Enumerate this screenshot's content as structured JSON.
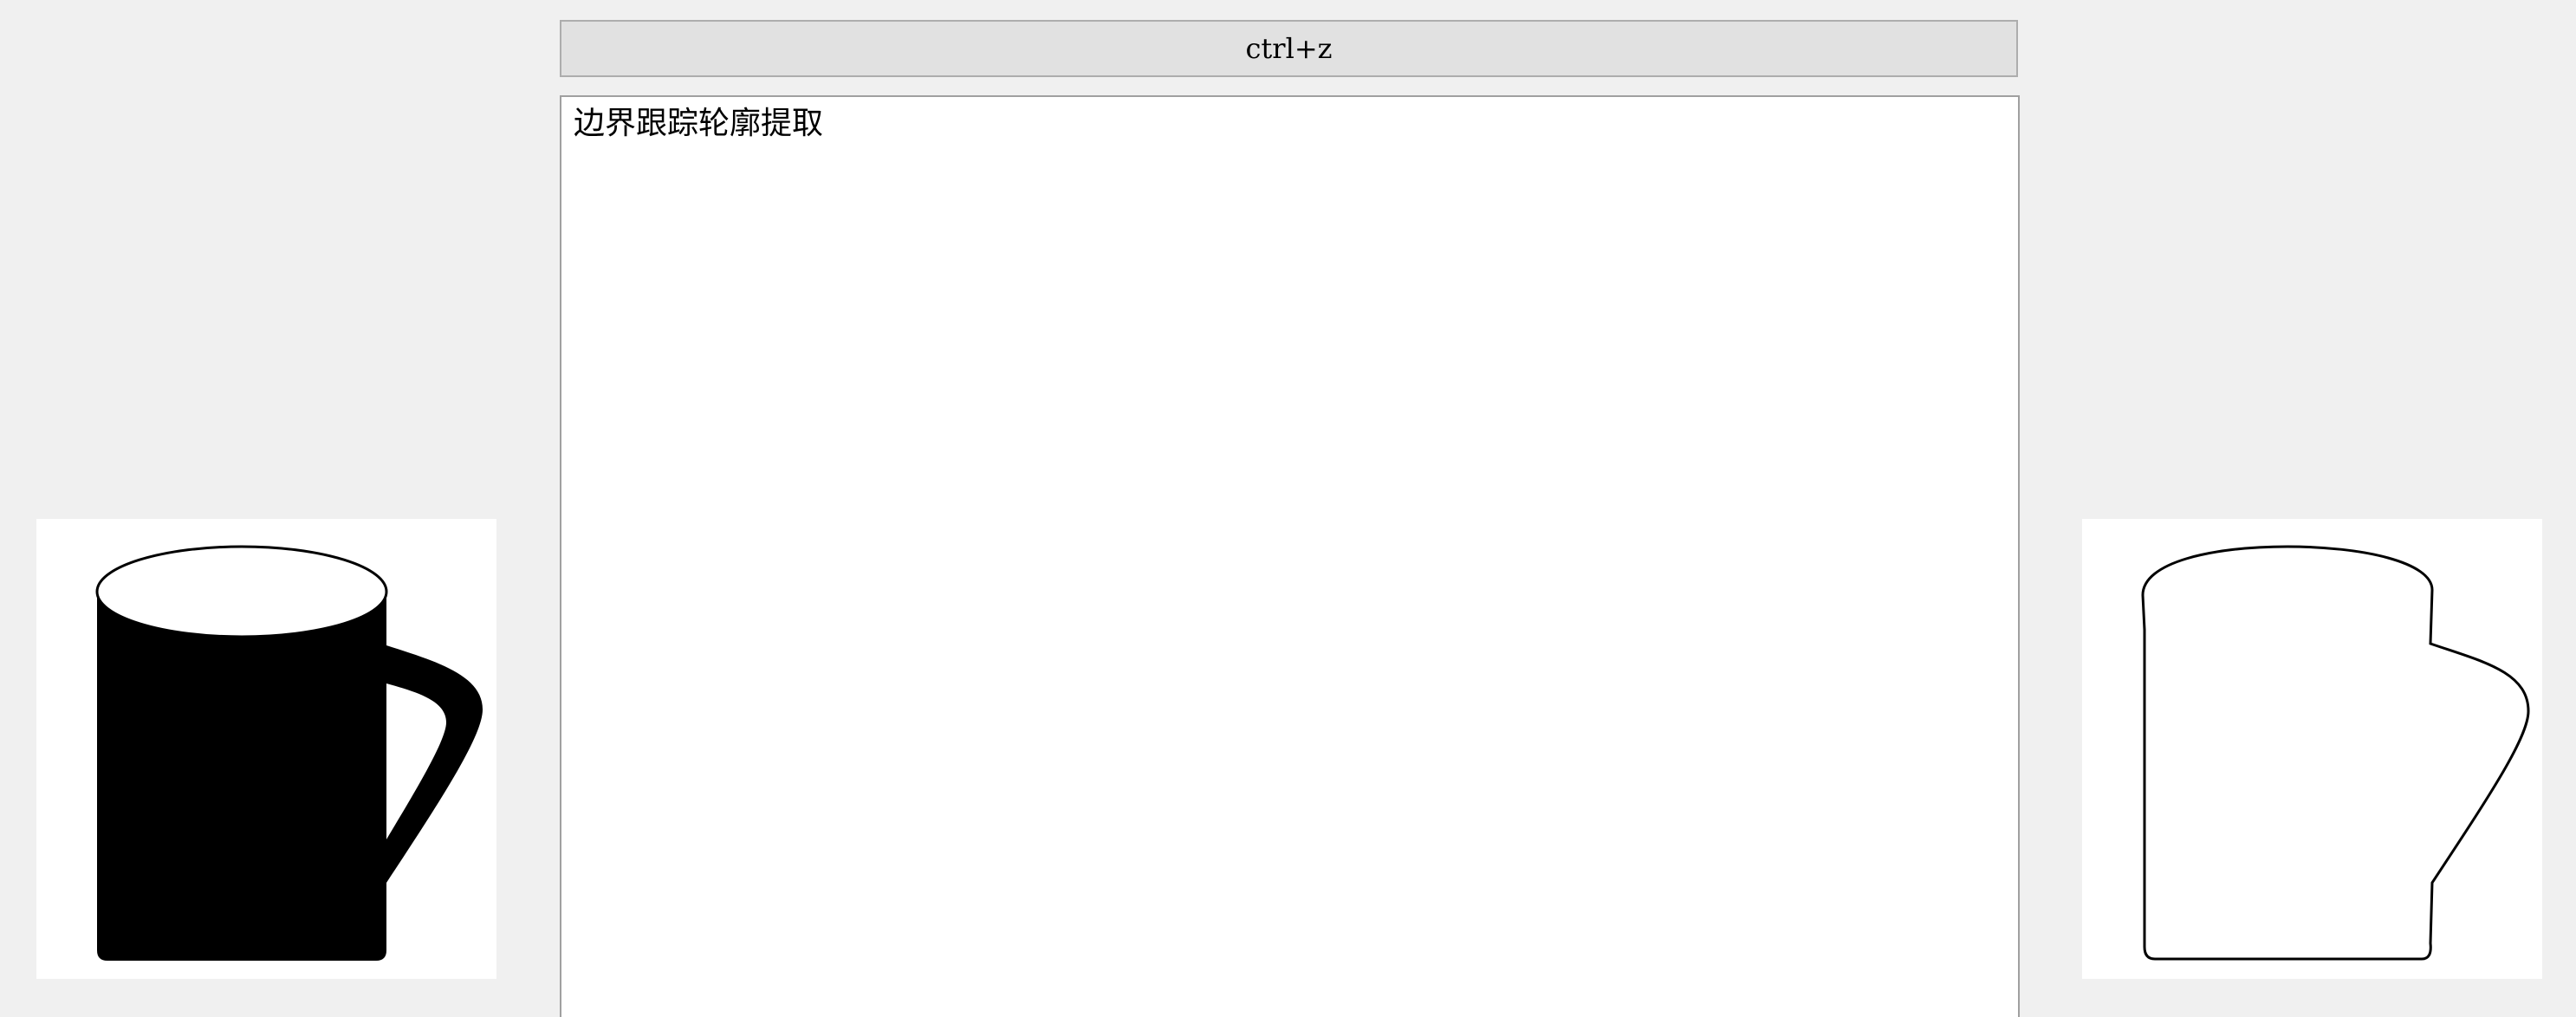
{
  "toolbar": {
    "undo_button_label": "ctrl+z"
  },
  "editor": {
    "text": "边界跟踪轮廓提取"
  },
  "images": {
    "source_image": "mug-filled-silhouette",
    "result_image": "mug-contour-outline"
  }
}
